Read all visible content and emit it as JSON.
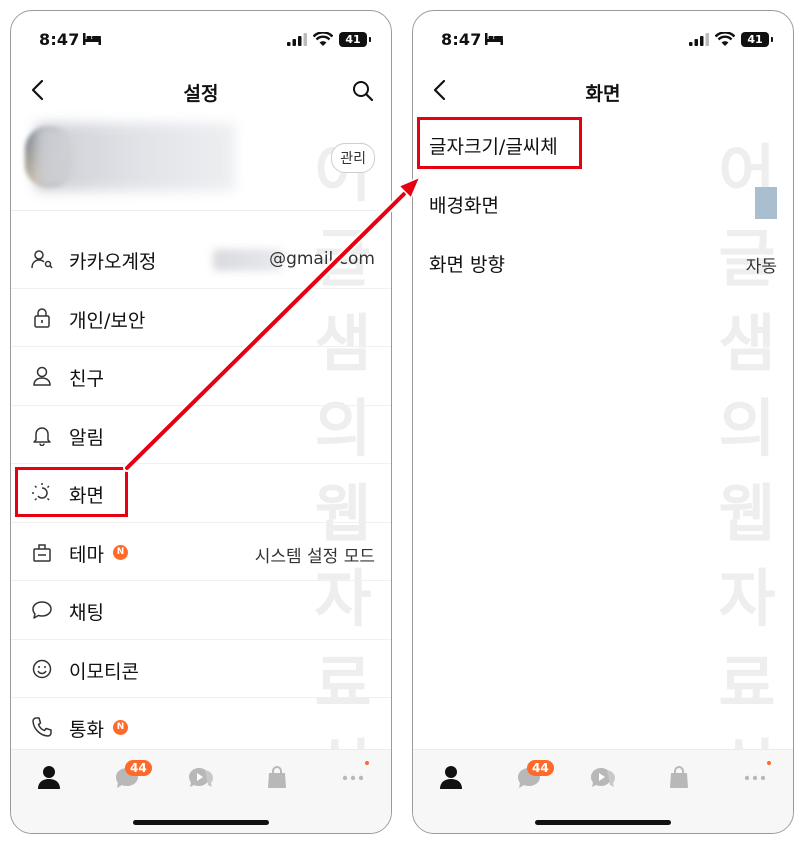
{
  "left_screen": {
    "status": {
      "time": "8:47",
      "battery": "41"
    },
    "nav": {
      "title": "설정"
    },
    "profile": {
      "manage_label": "관리"
    },
    "menu": [
      {
        "id": "kakao-account",
        "label": "카카오계정",
        "value": "@gmail.com",
        "icon": "account-icon"
      },
      {
        "id": "privacy",
        "label": "개인/보안",
        "value": "",
        "icon": "lock-icon"
      },
      {
        "id": "friends",
        "label": "친구",
        "value": "",
        "icon": "person-icon"
      },
      {
        "id": "notifications",
        "label": "알림",
        "value": "",
        "icon": "bell-icon"
      },
      {
        "id": "display",
        "label": "화면",
        "value": "",
        "icon": "display-icon"
      },
      {
        "id": "theme",
        "label": "테마",
        "value": "시스템 설정 모드",
        "icon": "theme-icon",
        "badge": "N"
      },
      {
        "id": "chat",
        "label": "채팅",
        "value": "",
        "icon": "chat-bubble-icon"
      },
      {
        "id": "emoticon",
        "label": "이모티콘",
        "value": "",
        "icon": "emoticon-icon"
      },
      {
        "id": "call",
        "label": "통화",
        "value": "",
        "icon": "phone-icon",
        "badge": "N"
      }
    ],
    "tab_badge": "44"
  },
  "right_screen": {
    "status": {
      "time": "8:47",
      "battery": "41"
    },
    "nav": {
      "title": "화면"
    },
    "settings": [
      {
        "id": "font",
        "label": "글자크기/글씨체",
        "value": ""
      },
      {
        "id": "background",
        "label": "배경화면",
        "value": ""
      },
      {
        "id": "orientation",
        "label": "화면 방향",
        "value": "자동"
      }
    ],
    "tab_badge": "44"
  },
  "watermark": [
    "어",
    "글",
    "샘",
    "의",
    "웹",
    "자",
    "료",
    "실"
  ],
  "colors": {
    "highlight": "#e60012",
    "badge": "#ff6a2b",
    "background_swatch": "#a9bfd0"
  }
}
